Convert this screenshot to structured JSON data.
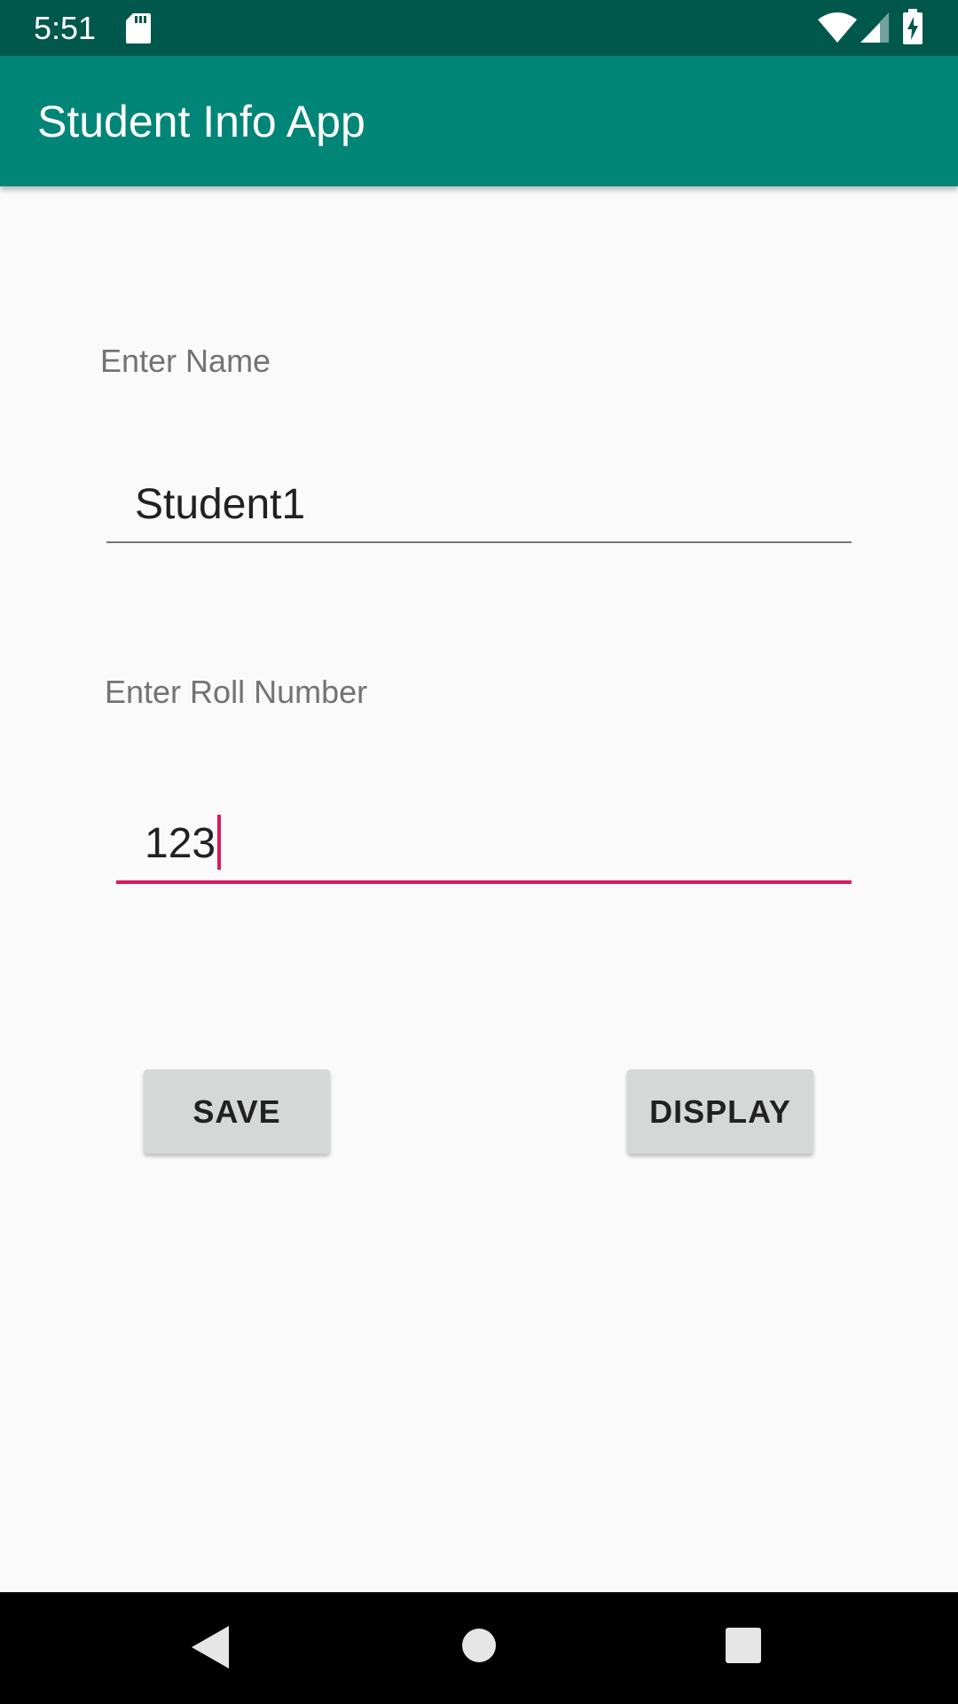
{
  "status_bar": {
    "time": "5:51",
    "icons": [
      "sd-card-icon",
      "wifi-icon",
      "cell-signal-icon",
      "battery-charging-icon"
    ]
  },
  "app_bar": {
    "title": "Student Info App",
    "color": "#008577"
  },
  "form": {
    "name_label": "Enter Name",
    "name_value": "Student1",
    "roll_label": "Enter Roll Number",
    "roll_value": "123"
  },
  "buttons": {
    "save_label": "SAVE",
    "display_label": "DISPLAY"
  },
  "nav_bar": {
    "icons": [
      "back-icon",
      "home-icon",
      "recents-icon"
    ]
  },
  "colors": {
    "status_bar": "#00574b",
    "accent": "#d81b60",
    "background": "#fafafa"
  }
}
